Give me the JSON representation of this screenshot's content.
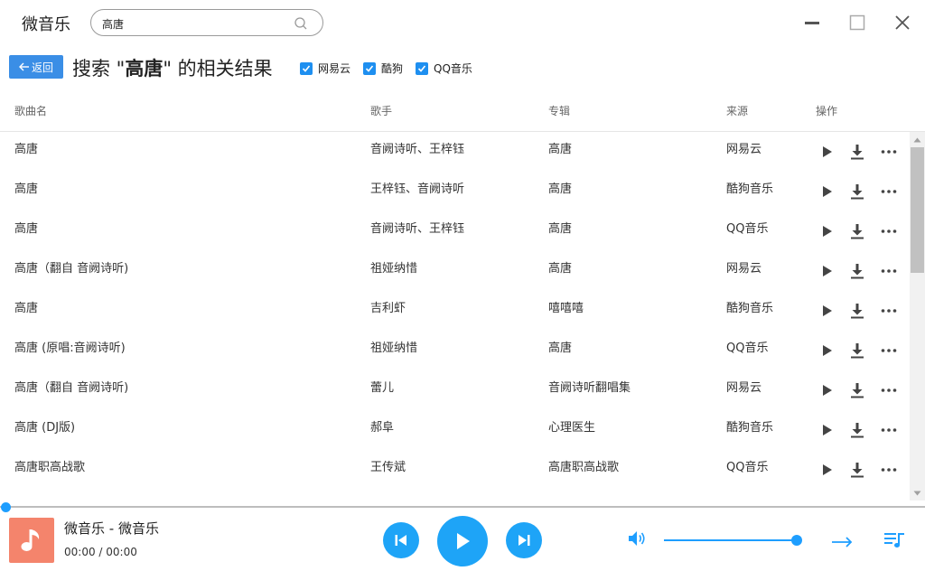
{
  "app": {
    "title": "微音乐"
  },
  "search": {
    "value": "高唐"
  },
  "header": {
    "back_label": "返回",
    "heading_prefix": "搜索 \"",
    "heading_keyword": "高唐",
    "heading_suffix": "\" 的相关结果",
    "filters": [
      {
        "label": "网易云",
        "checked": true
      },
      {
        "label": "酷狗",
        "checked": true
      },
      {
        "label": "QQ音乐",
        "checked": true
      }
    ]
  },
  "table": {
    "columns": {
      "name": "歌曲名",
      "artist": "歌手",
      "album": "专辑",
      "source": "来源",
      "ops": "操作"
    },
    "rows": [
      {
        "name": "高唐",
        "artist": "音阙诗听、王梓钰",
        "album": "高唐",
        "source": "网易云"
      },
      {
        "name": "高唐",
        "artist": "王梓钰、音阙诗听",
        "album": "高唐",
        "source": "酷狗音乐"
      },
      {
        "name": "高唐",
        "artist": "音阙诗听、王梓钰",
        "album": "高唐",
        "source": "QQ音乐"
      },
      {
        "name": "高唐（翻自 音阙诗听)",
        "artist": "祖娅纳惜",
        "album": "高唐",
        "source": "网易云"
      },
      {
        "name": "高唐",
        "artist": "吉利虾",
        "album": "嘻嘻嘻",
        "source": "酷狗音乐"
      },
      {
        "name": "高唐 (原唱:音阙诗听)",
        "artist": "祖娅纳惜",
        "album": "高唐",
        "source": "QQ音乐"
      },
      {
        "name": "高唐（翻自 音阙诗听)",
        "artist": "蕾儿",
        "album": "音阙诗听翻唱集",
        "source": "网易云"
      },
      {
        "name": "高唐 (DJ版)",
        "artist": "郝阜",
        "album": "心理医生",
        "source": "酷狗音乐"
      },
      {
        "name": "高唐职高战歌",
        "artist": "王传斌",
        "album": "高唐职高战歌",
        "source": "QQ音乐"
      }
    ]
  },
  "player": {
    "track_title": "微音乐 - 微音乐",
    "time": "00:00 / 00:00",
    "progress_percent": 0,
    "volume_percent": 100,
    "accent_color": "#1ea4f7",
    "cover_color": "#f4846c"
  }
}
